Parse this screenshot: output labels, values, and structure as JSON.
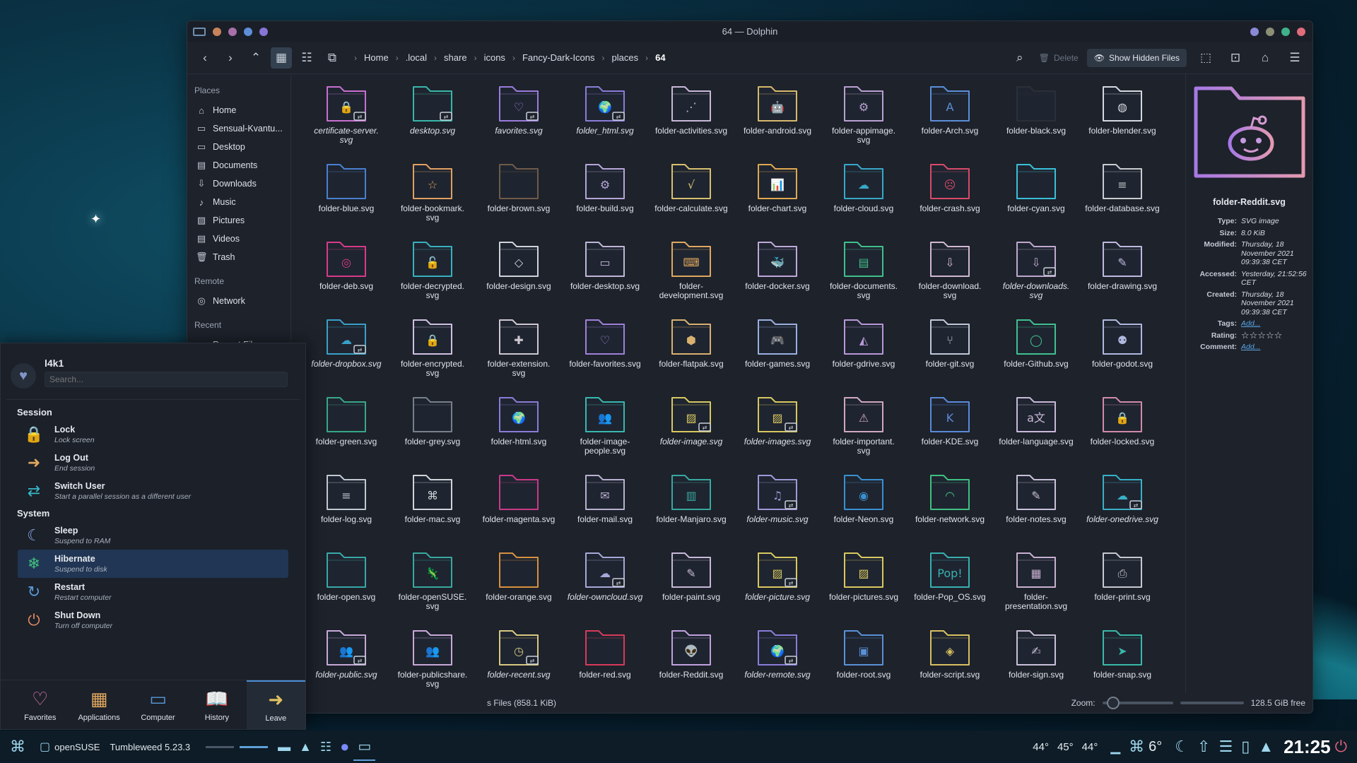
{
  "window": {
    "title": "64 — Dolphin",
    "dots": [
      "#c7835a",
      "#a770a8",
      "#5d8fd8",
      "#8875d8"
    ],
    "right_dots": [
      "#8a89d8",
      "#8b8f76",
      "#3fb28a",
      "#e06b7b"
    ]
  },
  "breadcrumb": [
    "Home",
    ".local",
    "share",
    "icons",
    "Fancy-Dark-Icons",
    "places",
    "64"
  ],
  "toolbar": {
    "delete": "Delete",
    "show_hidden": "Show Hidden Files"
  },
  "places": {
    "places_title": "Places",
    "items": [
      {
        "label": "Home",
        "icon": "⌂"
      },
      {
        "label": "Sensual-Kvantu...",
        "icon": "▭"
      },
      {
        "label": "Desktop",
        "icon": "▭"
      },
      {
        "label": "Documents",
        "icon": "▤"
      },
      {
        "label": "Downloads",
        "icon": "⇩"
      },
      {
        "label": "Music",
        "icon": "♪"
      },
      {
        "label": "Pictures",
        "icon": "▨"
      },
      {
        "label": "Videos",
        "icon": "▤"
      },
      {
        "label": "Trash",
        "icon": "🗑"
      }
    ],
    "remote_title": "Remote",
    "remote": [
      {
        "label": "Network",
        "icon": "◎"
      }
    ],
    "recent_title": "Recent",
    "recent": [
      {
        "label": "Recent Files",
        "icon": "▭"
      }
    ]
  },
  "files": [
    {
      "n": "certificate-server.\nsvg",
      "c": "#c86fd0",
      "g": "🔒",
      "it": true,
      "b": true
    },
    {
      "n": "desktop.svg",
      "c": "#38b6a8",
      "g": "",
      "it": true,
      "b": true
    },
    {
      "n": "favorites.svg",
      "c": "#9b7cdc",
      "g": "♡",
      "it": true,
      "b": true
    },
    {
      "n": "folder_html.svg",
      "c": "#8a7cd8",
      "g": "🌍",
      "it": true,
      "b": true
    },
    {
      "n": "folder-activities.svg",
      "c": "#c9b8d6",
      "g": "⋰",
      "it": false,
      "b": false
    },
    {
      "n": "folder-android.svg",
      "c": "#d7b86b",
      "g": "🤖",
      "it": false,
      "b": false
    },
    {
      "n": "folder-appimage.\nsvg",
      "c": "#b9a0d0",
      "g": "⚙",
      "it": false,
      "b": false
    },
    {
      "n": "folder-Arch.svg",
      "c": "#5b8fd8",
      "g": "A",
      "it": false,
      "b": false
    },
    {
      "n": "folder-black.svg",
      "c": "#2a2f38",
      "g": "",
      "it": false,
      "b": false
    },
    {
      "n": "folder-blender.svg",
      "c": "#d4d8de",
      "g": "◍",
      "it": false,
      "b": false
    },
    {
      "n": "folder-blue.svg",
      "c": "#4a7fd0",
      "g": "",
      "it": false,
      "b": false
    },
    {
      "n": "folder-bookmark.\nsvg",
      "c": "#e0a060",
      "g": "☆",
      "it": false,
      "b": false
    },
    {
      "n": "folder-brown.svg",
      "c": "#6f5a48",
      "g": "",
      "it": false,
      "b": false
    },
    {
      "n": "folder-build.svg",
      "c": "#b6a5d8",
      "g": "⚙",
      "it": false,
      "b": false
    },
    {
      "n": "folder-calculate.svg",
      "c": "#d8c070",
      "g": "√",
      "it": false,
      "b": false
    },
    {
      "n": "folder-chart.svg",
      "c": "#e0a850",
      "g": "📊",
      "it": false,
      "b": false
    },
    {
      "n": "folder-cloud.svg",
      "c": "#38a8c8",
      "g": "☁",
      "it": false,
      "b": false
    },
    {
      "n": "folder-crash.svg",
      "c": "#d84a6a",
      "g": "☹",
      "it": false,
      "b": false
    },
    {
      "n": "folder-cyan.svg",
      "c": "#3ac0d8",
      "g": "",
      "it": false,
      "b": false
    },
    {
      "n": "folder-database.svg",
      "c": "#c8cbd0",
      "g": "≡",
      "it": false,
      "b": false
    },
    {
      "n": "folder-deb.svg",
      "c": "#d83a8a",
      "g": "◎",
      "it": false,
      "b": false
    },
    {
      "n": "folder-decrypted.\nsvg",
      "c": "#38b0c0",
      "g": "🔓",
      "it": false,
      "b": false
    },
    {
      "n": "folder-design.svg",
      "c": "#d0d4da",
      "g": "◇",
      "it": false,
      "b": false
    },
    {
      "n": "folder-desktop.svg",
      "c": "#c0b6d8",
      "g": "▭",
      "it": false,
      "b": false
    },
    {
      "n": "folder-\ndevelopment.svg",
      "c": "#e0a860",
      "g": "⌨",
      "it": false,
      "b": false
    },
    {
      "n": "folder-docker.svg",
      "c": "#c0a8d8",
      "g": "🐳",
      "it": false,
      "b": false
    },
    {
      "n": "folder-documents.\nsvg",
      "c": "#40c08a",
      "g": "▤",
      "it": false,
      "b": false
    },
    {
      "n": "folder-download.\nsvg",
      "c": "#d0b8d0",
      "g": "⇩",
      "it": false,
      "b": false
    },
    {
      "n": "folder-downloads.\nsvg",
      "c": "#c0a8d0",
      "g": "⇩",
      "it": true,
      "b": true
    },
    {
      "n": "folder-drawing.svg",
      "c": "#c0b8e0",
      "g": "✎",
      "it": false,
      "b": false
    },
    {
      "n": "folder-dropbox.svg",
      "c": "#3aa0c8",
      "g": "☁",
      "it": true,
      "b": true
    },
    {
      "n": "folder-encrypted.\nsvg",
      "c": "#d0c0e0",
      "g": "🔒",
      "it": false,
      "b": false
    },
    {
      "n": "folder-extension.\nsvg",
      "c": "#d0c8d0",
      "g": "✚",
      "it": false,
      "b": false
    },
    {
      "n": "folder-favorites.svg",
      "c": "#a080d8",
      "g": "♡",
      "it": false,
      "b": false
    },
    {
      "n": "folder-flatpak.svg",
      "c": "#d8b070",
      "g": "⬢",
      "it": false,
      "b": false
    },
    {
      "n": "folder-games.svg",
      "c": "#9ab0e0",
      "g": "🎮",
      "it": false,
      "b": false
    },
    {
      "n": "folder-gdrive.svg",
      "c": "#b898d8",
      "g": "◭",
      "it": false,
      "b": false
    },
    {
      "n": "folder-git.svg",
      "c": "#c0c8d8",
      "g": "⑂",
      "it": false,
      "b": false
    },
    {
      "n": "folder-Github.svg",
      "c": "#40c090",
      "g": "◯",
      "it": false,
      "b": false
    },
    {
      "n": "folder-godot.svg",
      "c": "#b0b8e0",
      "g": "⚉",
      "it": false,
      "b": false
    },
    {
      "n": "folder-green.svg",
      "c": "#38a888",
      "g": "",
      "it": false,
      "b": false
    },
    {
      "n": "folder-grey.svg",
      "c": "#7a808a",
      "g": "",
      "it": false,
      "b": false
    },
    {
      "n": "folder-html.svg",
      "c": "#8a7cd8",
      "g": "🌍",
      "it": false,
      "b": false
    },
    {
      "n": "folder-image-\npeople.svg",
      "c": "#38b8b0",
      "g": "👥",
      "it": false,
      "b": false
    },
    {
      "n": "folder-image.svg",
      "c": "#d8c860",
      "g": "▨",
      "it": true,
      "b": true
    },
    {
      "n": "folder-images.svg",
      "c": "#d8c860",
      "g": "▨",
      "it": true,
      "b": true
    },
    {
      "n": "folder-important.\nsvg",
      "c": "#d0a8c0",
      "g": "⚠",
      "it": false,
      "b": false
    },
    {
      "n": "folder-KDE.svg",
      "c": "#5a8ad8",
      "g": "K",
      "it": false,
      "b": false
    },
    {
      "n": "folder-language.svg",
      "c": "#c8b8d8",
      "g": "a文",
      "it": false,
      "b": false
    },
    {
      "n": "folder-locked.svg",
      "c": "#d08aa8",
      "g": "🔒",
      "it": false,
      "b": false
    },
    {
      "n": "folder-log.svg",
      "c": "#c0c8d0",
      "g": "≡",
      "it": false,
      "b": false
    },
    {
      "n": "folder-mac.svg",
      "c": "#d0d4d8",
      "g": "⌘",
      "it": false,
      "b": false
    },
    {
      "n": "folder-magenta.svg",
      "c": "#c83a8a",
      "g": "",
      "it": false,
      "b": false
    },
    {
      "n": "folder-mail.svg",
      "c": "#b8b0d0",
      "g": "✉",
      "it": false,
      "b": false
    },
    {
      "n": "folder-Manjaro.svg",
      "c": "#38a8a0",
      "g": "▥",
      "it": false,
      "b": false
    },
    {
      "n": "folder-music.svg",
      "c": "#a098d8",
      "g": "♫",
      "it": true,
      "b": true
    },
    {
      "n": "folder-Neon.svg",
      "c": "#3a90d0",
      "g": "◉",
      "it": false,
      "b": false
    },
    {
      "n": "folder-network.svg",
      "c": "#40c080",
      "g": "◠",
      "it": false,
      "b": false
    },
    {
      "n": "folder-notes.svg",
      "c": "#c8c0d8",
      "g": "✎",
      "it": false,
      "b": false
    },
    {
      "n": "folder-onedrive.svg",
      "c": "#38b0c8",
      "g": "☁",
      "it": true,
      "b": true
    },
    {
      "n": "folder-open.svg",
      "c": "#38a8a8",
      "g": "",
      "it": false,
      "b": false
    },
    {
      "n": "folder-openSUSE.\nsvg",
      "c": "#38a8a0",
      "g": "🦎",
      "it": false,
      "b": false
    },
    {
      "n": "folder-orange.svg",
      "c": "#d89040",
      "g": "",
      "it": false,
      "b": false
    },
    {
      "n": "folder-owncloud.svg",
      "c": "#a8a8d8",
      "g": "☁",
      "it": true,
      "b": true
    },
    {
      "n": "folder-paint.svg",
      "c": "#c8b8d8",
      "g": "✎",
      "it": false,
      "b": false
    },
    {
      "n": "folder-picture.svg",
      "c": "#d8c860",
      "g": "▨",
      "it": true,
      "b": true
    },
    {
      "n": "folder-pictures.svg",
      "c": "#d8c860",
      "g": "▨",
      "it": false,
      "b": false
    },
    {
      "n": "folder-Pop_OS.svg",
      "c": "#38b0b0",
      "g": "Pop!",
      "it": false,
      "b": false
    },
    {
      "n": "folder-\npresentation.svg",
      "c": "#c8b0d0",
      "g": "▦",
      "it": false,
      "b": false
    },
    {
      "n": "folder-print.svg",
      "c": "#c8c8d0",
      "g": "⎙",
      "it": false,
      "b": false
    },
    {
      "n": "folder-public.svg",
      "c": "#c8a8d8",
      "g": "👥",
      "it": true,
      "b": true
    },
    {
      "n": "folder-publicshare.\nsvg",
      "c": "#c8a8d8",
      "g": "👥",
      "it": false,
      "b": false
    },
    {
      "n": "folder-recent.svg",
      "c": "#d8c880",
      "g": "◷",
      "it": true,
      "b": true
    },
    {
      "n": "folder-red.svg",
      "c": "#d83a5a",
      "g": "",
      "it": false,
      "b": false
    },
    {
      "n": "folder-Reddit.svg",
      "c": "#c0a0e0",
      "g": "👽",
      "it": false,
      "b": false
    },
    {
      "n": "folder-remote.svg",
      "c": "#8a7cd8",
      "g": "🌍",
      "it": true,
      "b": true
    },
    {
      "n": "folder-root.svg",
      "c": "#5a90d8",
      "g": "▣",
      "it": false,
      "b": false
    },
    {
      "n": "folder-script.svg",
      "c": "#d8c060",
      "g": "◈",
      "it": false,
      "b": false
    },
    {
      "n": "folder-sign.svg",
      "c": "#c8c0d8",
      "g": "✍",
      "it": false,
      "b": false
    },
    {
      "n": "folder-snap.svg",
      "c": "#38b8a8",
      "g": "➤",
      "it": false,
      "b": false
    }
  ],
  "status": {
    "files": "s Files (858.1 KiB)",
    "zoom_label": "Zoom:",
    "free": "128.5 GiB free",
    "zoom_level": 0.15,
    "used_fraction": 1.0
  },
  "info": {
    "name": "folder-Reddit.svg",
    "type_l": "Type:",
    "type_v": "SVG image",
    "size_l": "Size:",
    "size_v": "8.0 KiB",
    "mod_l": "Modified:",
    "mod_v": "Thursday, 18\nNovember 2021\n09:39:38 CET",
    "acc_l": "Accessed:",
    "acc_v": "Yesterday, 21:52:56\nCET",
    "cre_l": "Created:",
    "cre_v": "Thursday, 18\nNovember 2021\n09:39:38 CET",
    "tags_l": "Tags:",
    "tags_v": "Add...",
    "rating_l": "Rating:",
    "rating_v": "☆☆☆☆☆",
    "comment_l": "Comment:",
    "comment_v": "Add..."
  },
  "launcher": {
    "user": "l4k1",
    "search_placeholder": "Search...",
    "session_title": "Session",
    "session": [
      {
        "t": "Lock",
        "s": "Lock screen",
        "icon": "🔒",
        "color": "#e07aa8"
      },
      {
        "t": "Log Out",
        "s": "End session",
        "icon": "➜",
        "color": "#e0a860"
      },
      {
        "t": "Switch User",
        "s": "Start a parallel session as a different user",
        "icon": "⇄",
        "color": "#3ab8c8"
      }
    ],
    "system_title": "System",
    "system": [
      {
        "t": "Sleep",
        "s": "Suspend to RAM",
        "icon": "☾",
        "color": "#8aa0e0"
      },
      {
        "t": "Hibernate",
        "s": "Suspend to disk",
        "icon": "❄",
        "color": "#40c080"
      },
      {
        "t": "Restart",
        "s": "Restart computer",
        "icon": "↻",
        "color": "#5a9ad8"
      },
      {
        "t": "Shut Down",
        "s": "Turn off computer",
        "icon": "⏻",
        "color": "#e08a60"
      }
    ],
    "tabs": [
      {
        "label": "Favorites",
        "icon": "♡",
        "color": "#e07aa8"
      },
      {
        "label": "Applications",
        "icon": "▦",
        "color": "#e0a860"
      },
      {
        "label": "Computer",
        "icon": "▭",
        "color": "#5a9ad8"
      },
      {
        "label": "History",
        "icon": "📖",
        "color": "#40c0a0"
      },
      {
        "label": "Leave",
        "icon": "➜",
        "color": "#e0c060"
      }
    ]
  },
  "panel": {
    "launcher_icon": "⌘",
    "task_label1": "openSUSE",
    "task_label2": "Tumbleweed 5.23.3",
    "temps": [
      "44°",
      "45°",
      "44°"
    ],
    "weather": "6°",
    "clock": "21:25"
  }
}
